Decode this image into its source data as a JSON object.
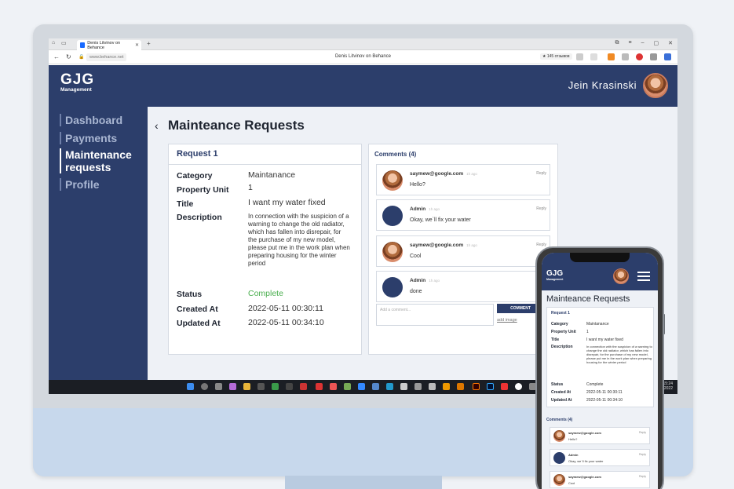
{
  "browser": {
    "tab_title": "Denis Litvinov on Behance",
    "tab_close": "✕",
    "new_tab": "+",
    "url": "www.behance.net",
    "page_title": "Denis Litvinov on Behance",
    "rating": "★ 145 отзывов",
    "win_buttons": [
      "⧉",
      "≡",
      "–",
      "▢",
      "✕"
    ],
    "nav": {
      "back": "←",
      "reload": "↻",
      "lock": "🔒"
    }
  },
  "app": {
    "brand_big": "GJG",
    "brand_small": "Management",
    "user_name": "Jein Krasinski",
    "sidebar": [
      "Dashboard",
      "Payments",
      "Maintenance requests",
      "Profile"
    ],
    "active_index": 2,
    "page_title": "Mainteance Requests",
    "back_icon": "‹"
  },
  "request": {
    "header": "Request 1",
    "fields": [
      {
        "label": "Category",
        "value": "Maintanance"
      },
      {
        "label": "Property Unit",
        "value": "1"
      },
      {
        "label": "Title",
        "value": "I want my water fixed"
      },
      {
        "label": "Description",
        "value": "In connection with the suspicion of a warning to change the old radiator, which has fallen into disrepair, for the purchase of my new model, please put me in the work plan when preparing housing for the winter period"
      },
      {
        "label": "Status",
        "value": "Complete"
      },
      {
        "label": "Created At",
        "value": "2022-05-11 00:30:11"
      },
      {
        "label": "Updated At",
        "value": "2022-05-11 00:34:10"
      }
    ],
    "status_color": "#4caf50"
  },
  "comments": {
    "header": "Comments (4)",
    "items": [
      {
        "author": "saymew@google.com",
        "ago": "1h ago",
        "text": "Hello?",
        "avatar": "photo"
      },
      {
        "author": "Admin",
        "ago": "1h ago",
        "text": "Okay, we`ll fix your water",
        "avatar": "navy"
      },
      {
        "author": "saymew@google.com",
        "ago": "1h ago",
        "text": "Cool",
        "avatar": "photo"
      },
      {
        "author": "Admin",
        "ago": "1h ago",
        "text": "done",
        "avatar": "navy"
      }
    ],
    "reply_label": "Reply",
    "input_placeholder": "Add a comment...",
    "submit_label": "COMMENT",
    "add_image_label": "add image"
  },
  "taskbar": {
    "time": "15:24",
    "date": "2022"
  },
  "phone": {
    "brand_big": "GJG",
    "brand_small": "Management",
    "page_title": "Mainteance Requests",
    "request_header": "Request 1",
    "desc_lines": "In connection with the suspicion of a warning to change the old radiator, which has fallen into disrepair, for the purchase of my new model, please put me in the work plan when preparing housing for the winter period",
    "comments_header": "Comments (4)"
  },
  "colors": {
    "navy": "#2c3e6b",
    "status_green": "#4caf50",
    "content_bg": "#eef1f6"
  }
}
